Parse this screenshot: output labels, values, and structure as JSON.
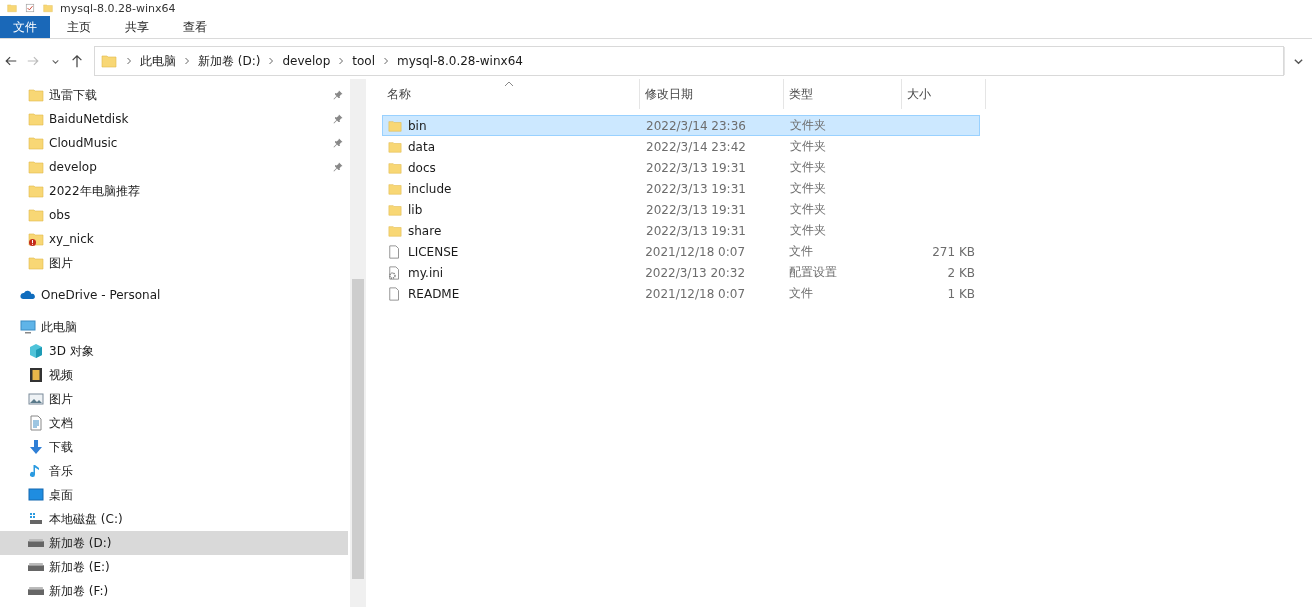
{
  "window": {
    "title": "mysql-8.0.28-winx64"
  },
  "ribbon_tabs": [
    {
      "label": "文件",
      "selected": true
    },
    {
      "label": "主页",
      "selected": false
    },
    {
      "label": "共享",
      "selected": false
    },
    {
      "label": "查看",
      "selected": false
    }
  ],
  "address_bar": {
    "breadcrumbs": [
      "此电脑",
      "新加卷 (D:)",
      "develop",
      "tool",
      "mysql-8.0.28-winx64"
    ]
  },
  "sidebar": {
    "quick_access": [
      {
        "label": "迅雷下载",
        "kind": "folder",
        "pinned": true,
        "selected": false
      },
      {
        "label": "BaiduNetdisk",
        "kind": "folder",
        "pinned": true,
        "selected": false
      },
      {
        "label": "CloudMusic",
        "kind": "folder",
        "pinned": true,
        "selected": false
      },
      {
        "label": "develop",
        "kind": "folder",
        "pinned": true,
        "selected": false
      },
      {
        "label": "2022年电脑推荐",
        "kind": "folder",
        "pinned": false,
        "selected": false
      },
      {
        "label": "obs",
        "kind": "folder",
        "pinned": false,
        "selected": false
      },
      {
        "label": "xy_nick",
        "kind": "folder-error",
        "pinned": false,
        "selected": false
      },
      {
        "label": "图片",
        "kind": "folder",
        "pinned": false,
        "selected": false
      }
    ],
    "onedrive": {
      "label": "OneDrive - Personal",
      "kind": "cloud",
      "selected": false
    },
    "this_pc": {
      "label": "此电脑",
      "kind": "pc",
      "selected": false,
      "children": [
        {
          "label": "3D 对象",
          "kind": "cube",
          "selected": false
        },
        {
          "label": "视频",
          "kind": "video",
          "selected": false
        },
        {
          "label": "图片",
          "kind": "picture",
          "selected": false
        },
        {
          "label": "文档",
          "kind": "document",
          "selected": false
        },
        {
          "label": "下载",
          "kind": "download",
          "selected": false
        },
        {
          "label": "音乐",
          "kind": "music",
          "selected": false
        },
        {
          "label": "桌面",
          "kind": "desktop",
          "selected": false
        },
        {
          "label": "本地磁盘 (C:)",
          "kind": "system-drive",
          "selected": false
        },
        {
          "label": "新加卷 (D:)",
          "kind": "drive",
          "selected": true
        },
        {
          "label": "新加卷 (E:)",
          "kind": "drive",
          "selected": false
        },
        {
          "label": "新加卷 (F:)",
          "kind": "drive",
          "selected": false
        }
      ]
    }
  },
  "table": {
    "columns": [
      "名称",
      "修改日期",
      "类型",
      "大小"
    ],
    "rows": [
      {
        "name": "bin",
        "modified": "2022/3/14 23:36",
        "type": "文件夹",
        "kind": "folder",
        "selected": true
      },
      {
        "name": "data",
        "modified": "2022/3/14 23:42",
        "type": "文件夹",
        "kind": "folder",
        "selected": false
      },
      {
        "name": "docs",
        "modified": "2022/3/13 19:31",
        "type": "文件夹",
        "kind": "folder",
        "selected": false
      },
      {
        "name": "include",
        "modified": "2022/3/13 19:31",
        "type": "文件夹",
        "kind": "folder",
        "selected": false
      },
      {
        "name": "lib",
        "modified": "2022/3/13 19:31",
        "type": "文件夹",
        "kind": "folder",
        "selected": false
      },
      {
        "name": "share",
        "modified": "2022/3/13 19:31",
        "type": "文件夹",
        "kind": "folder",
        "selected": false
      },
      {
        "name": "LICENSE",
        "modified": "2021/12/18 0:07",
        "type": "文件",
        "size": "271 KB",
        "kind": "file",
        "selected": false
      },
      {
        "name": "my.ini",
        "modified": "2022/3/13 20:32",
        "type": "配置设置",
        "size": "2 KB",
        "kind": "config",
        "selected": false
      },
      {
        "name": "README",
        "modified": "2021/12/18 0:07",
        "type": "文件",
        "size": "1 KB",
        "kind": "file",
        "selected": false
      }
    ]
  }
}
